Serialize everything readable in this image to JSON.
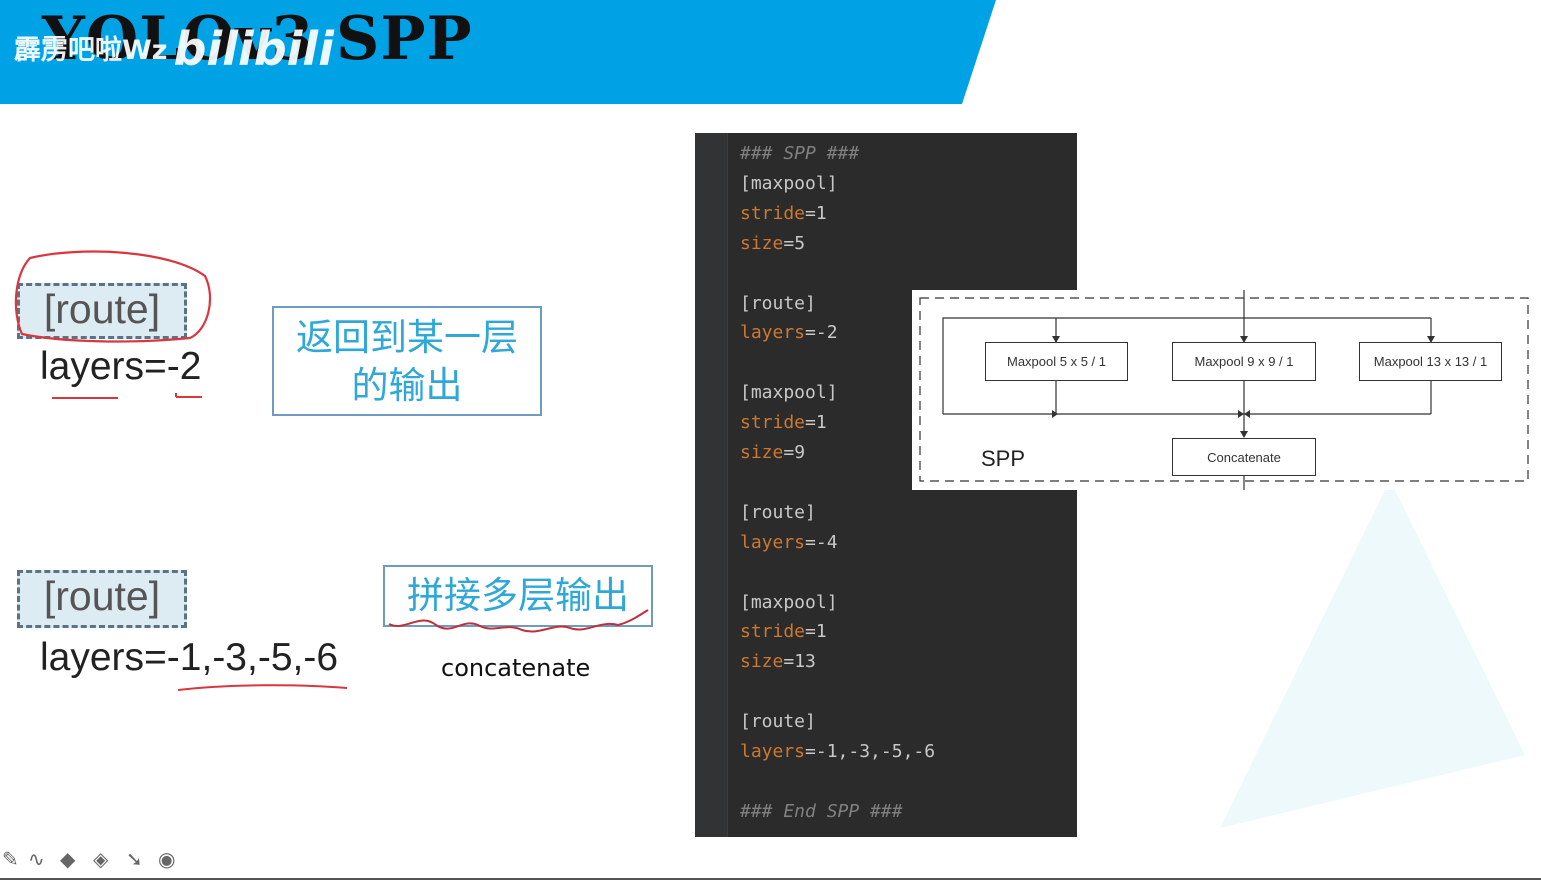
{
  "header": {
    "title": "YOLOv3 SPP",
    "watermark_text": "霹雳吧啦Wz",
    "watermark_logo": "bilibili",
    "banner_color": "#00a2e6"
  },
  "left": {
    "route1_label": "[route]",
    "route1_layers": "layers=-2",
    "route1_desc_line1": "返回到某一层",
    "route1_desc_line2": "的输出",
    "route2_label": "[route]",
    "route2_layers": "layers=-1,-3,-5,-6",
    "route2_desc": "拼接多层输出",
    "route2_en": "concatenate"
  },
  "code": {
    "lines": [
      {
        "text": "### SPP ###",
        "kind": "comment"
      },
      {
        "text": "[maxpool]",
        "kind": "section"
      },
      {
        "key": "stride",
        "value": "1",
        "kind": "kv"
      },
      {
        "key": "size",
        "value": "5",
        "kind": "kv"
      },
      {
        "text": "",
        "kind": "blank"
      },
      {
        "text": "[route]",
        "kind": "section"
      },
      {
        "key": "layers",
        "value": "-2",
        "kind": "kv"
      },
      {
        "text": "",
        "kind": "blank"
      },
      {
        "text": "[maxpool]",
        "kind": "section"
      },
      {
        "key": "stride",
        "value": "1",
        "kind": "kv"
      },
      {
        "key": "size",
        "value": "9",
        "kind": "kv"
      },
      {
        "text": "",
        "kind": "blank"
      },
      {
        "text": "[route]",
        "kind": "section"
      },
      {
        "key": "layers",
        "value": "-4",
        "kind": "kv"
      },
      {
        "text": "",
        "kind": "blank"
      },
      {
        "text": "[maxpool]",
        "kind": "section"
      },
      {
        "key": "stride",
        "value": "1",
        "kind": "kv"
      },
      {
        "key": "size",
        "value": "13",
        "kind": "kv"
      },
      {
        "text": "",
        "kind": "blank"
      },
      {
        "text": "[route]",
        "kind": "section"
      },
      {
        "key": "layers",
        "value": "-1,-3,-5,-6",
        "kind": "kv"
      },
      {
        "text": "",
        "kind": "blank"
      },
      {
        "text": "### End SPP ###",
        "kind": "comment"
      }
    ]
  },
  "spp_diagram": {
    "maxpool1": "Maxpool  5 x 5 / 1",
    "maxpool2": "Maxpool  9 x 9 / 1",
    "maxpool3": "Maxpool  13 x 13 / 1",
    "concat": "Concatenate",
    "label": "SPP"
  },
  "toolbar": {
    "icons": [
      "pen-icon",
      "curve-icon",
      "highlighter-icon",
      "eraser-icon",
      "pointer-icon",
      "record-icon"
    ]
  }
}
